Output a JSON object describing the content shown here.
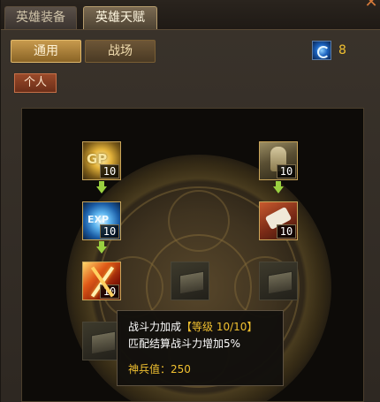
{
  "tabs": {
    "top": [
      {
        "label": "英雄装备",
        "active": false
      },
      {
        "label": "英雄天赋",
        "active": true
      }
    ],
    "sub": [
      {
        "label": "通用",
        "active": true
      },
      {
        "label": "战场",
        "active": false
      }
    ]
  },
  "talent_points": {
    "icon": "skill-point-orb-icon",
    "value": "8"
  },
  "category_label": "个人",
  "skills": [
    {
      "name": "gold-bonus-skill",
      "icon": "gold-coin-icon",
      "level": "10"
    },
    {
      "name": "warrior-skill",
      "icon": "armored-warrior-icon",
      "level": "10"
    },
    {
      "name": "exp-bonus-skill",
      "icon": "exp-orb-icon",
      "level": "10"
    },
    {
      "name": "scroll-skill",
      "icon": "scroll-fist-icon",
      "level": "10"
    },
    {
      "name": "combat-power-skill",
      "icon": "crossed-swords-icon",
      "level": "10"
    },
    {
      "name": "locked-skill-1",
      "icon": "locked-chest-icon",
      "level": ""
    },
    {
      "name": "locked-skill-2",
      "icon": "locked-chest-icon",
      "level": ""
    },
    {
      "name": "locked-skill-3",
      "icon": "locked-chest-icon",
      "level": ""
    }
  ],
  "tooltip": {
    "title": "战斗力加成",
    "level_text": "【等级 10/10】",
    "description": "匹配结算战斗力增加5%",
    "cost": "神兵值：250"
  },
  "colors": {
    "accent_gold": "#f0c030",
    "arrow_green": "#9ad040",
    "category_red": "#9a4a2a"
  }
}
